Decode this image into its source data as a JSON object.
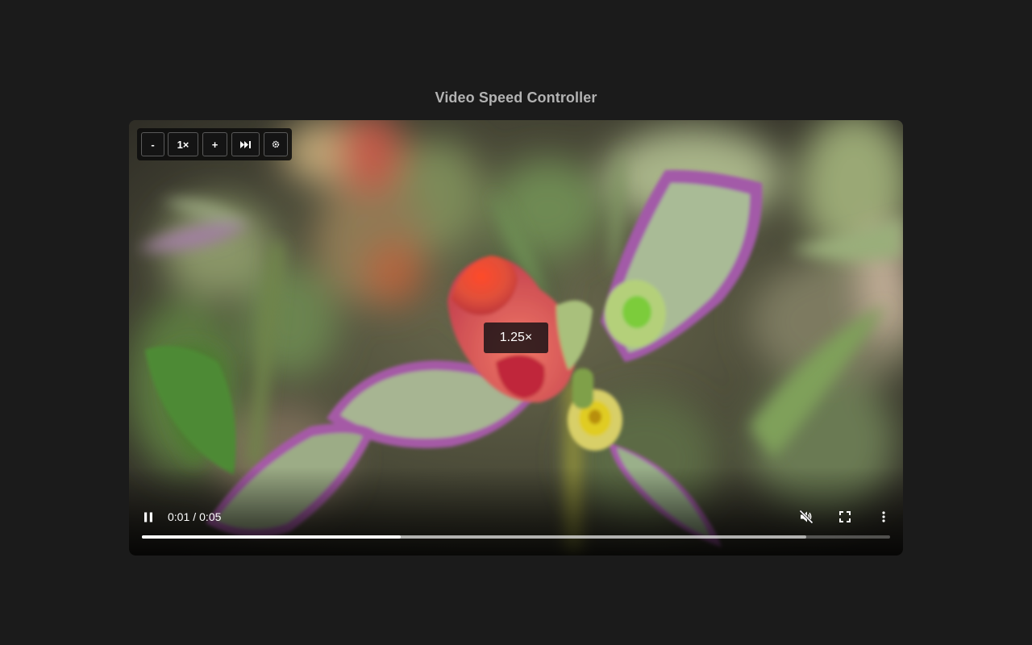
{
  "page": {
    "title": "Video Speed Controller"
  },
  "speed_controller": {
    "decrease_label": "-",
    "speed_label": "1×",
    "increase_label": "+",
    "skip_icon": "skip-forward-icon",
    "settings_icon": "gear-icon"
  },
  "speed_flash": {
    "value": "1.25×"
  },
  "controls": {
    "current_time": "0:01",
    "separator": "/",
    "duration": "0:05",
    "play_state_icon": "pause-icon",
    "mute_icon": "volume-muted-icon",
    "fullscreen_icon": "fullscreen-icon",
    "more_icon": "more-vertical-icon",
    "played_fraction": 0.346,
    "buffered_fraction": 0.888
  },
  "colors": {
    "page_background": "#1b1b1b",
    "title_text": "#b3b3b3",
    "control_text": "#ffffff"
  }
}
